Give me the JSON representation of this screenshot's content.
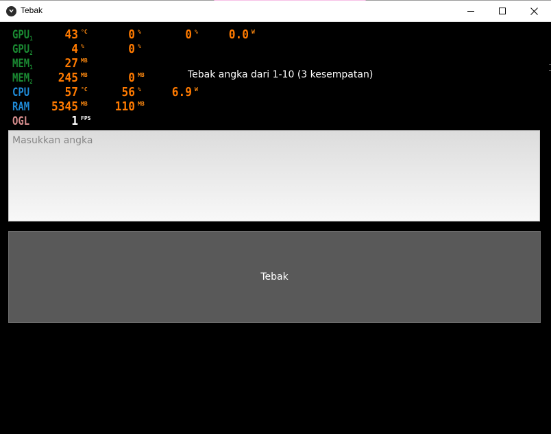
{
  "window": {
    "title": "Tebak",
    "controls": {
      "minimize": "minimize",
      "maximize": "maximize",
      "close": "close"
    }
  },
  "osd": {
    "rows": [
      {
        "label": "GPU",
        "sub": "1",
        "color": "#1a8a32",
        "values": [
          {
            "v": "43",
            "u": "°C"
          },
          {
            "v": "0",
            "u": "%"
          },
          {
            "v": "0",
            "u": "%"
          },
          {
            "v": "0.0",
            "u": "W"
          }
        ]
      },
      {
        "label": "GPU",
        "sub": "2",
        "color": "#1a8a32",
        "values": [
          {
            "v": "4",
            "u": "%"
          },
          {
            "v": "0",
            "u": "%"
          }
        ]
      },
      {
        "label": "MEM",
        "sub": "1",
        "color": "#1a8a32",
        "values": [
          {
            "v": "27",
            "u": "MB"
          }
        ]
      },
      {
        "label": "MEM",
        "sub": "2",
        "color": "#1a8a32",
        "values": [
          {
            "v": "245",
            "u": "MB"
          },
          {
            "v": "0",
            "u": "MB"
          }
        ]
      },
      {
        "label": "CPU",
        "sub": "",
        "color": "#1f8ad6",
        "values": [
          {
            "v": "57",
            "u": "°C"
          },
          {
            "v": "56",
            "u": "%"
          },
          {
            "v": "6.9",
            "u": "W"
          }
        ]
      },
      {
        "label": "RAM",
        "sub": "",
        "color": "#1f8ad6",
        "values": [
          {
            "v": "5345",
            "u": "MB"
          },
          {
            "v": "110",
            "u": "MB"
          }
        ]
      },
      {
        "label": "OGL",
        "sub": "",
        "color": "#d58c8c",
        "values": [
          {
            "v": "1",
            "u": "FPS"
          }
        ]
      }
    ]
  },
  "game": {
    "prompt": "Tebak angka dari 1-10 (3 kesempatan)",
    "input_placeholder": "Masukkan angka",
    "input_value": "",
    "button_label": "Tebak"
  }
}
